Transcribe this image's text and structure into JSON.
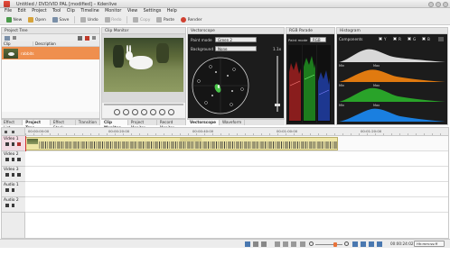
{
  "window": {
    "title": "Untitled / DVD/VID PAL [modified] – Kdenlive"
  },
  "menu": {
    "items": [
      "File",
      "Edit",
      "Project",
      "Tool",
      "Clip",
      "Timeline",
      "Monitor",
      "View",
      "Settings",
      "Help"
    ]
  },
  "toolbar": {
    "new_label": "New",
    "open_label": "Open",
    "save_label": "Save",
    "undo_label": "Undo",
    "redo_label": "Redo",
    "copy_label": "Copy",
    "paste_label": "Paste",
    "render_label": "Render"
  },
  "project_tree": {
    "title": "Project Tree",
    "col_clip": "Clip",
    "col_description": "Description",
    "clip_name": "rabbits"
  },
  "left_tabs": [
    "Effect List",
    "Project Tree",
    "Effect Stack",
    "Transition"
  ],
  "clip_monitor": {
    "title": "Clip Monitor",
    "tabs": [
      "Clip Monitor",
      "Project Monitor",
      "Record Monitor"
    ]
  },
  "vectorscope": {
    "title": "Vectorscope",
    "paint_mode_label": "Paint mode",
    "paint_mode_value": "Green 2",
    "background_label": "Background",
    "background_value": "None",
    "gain_value": "1.1x",
    "tabs": [
      "Vectorscope",
      "Waveform"
    ]
  },
  "rgb_parade": {
    "title": "RGB Parade",
    "paint_mode_label": "Paint mode",
    "paint_mode_value": "RGB"
  },
  "histogram": {
    "title": "Histogram",
    "components_label": "Components",
    "channel_labels": [
      "Y",
      "R",
      "G",
      "B"
    ],
    "min_label": "Min",
    "max_label": "Max"
  },
  "timeline": {
    "ruler_start": "00:00:00:00",
    "ruler_marks": [
      "00:00:20:00",
      "00:00:40:00",
      "00:01:00:00",
      "00:01:20:00"
    ],
    "tracks": [
      "Video 1",
      "Video 2",
      "Video 3",
      "Audio 1",
      "Audio 2"
    ]
  },
  "statusbar": {
    "timecode": "00:00:24:02",
    "mode": "Hh:mm:ss:ff"
  },
  "colors": {
    "accent": "#e8723a",
    "selection_orange": "#f0a36e",
    "clip_yellow": "#eee6a6",
    "video_track_pink": "#f3dbe3",
    "histogram_y": "#d8d8d8",
    "histogram_r": "#e07a10",
    "histogram_g": "#29a329",
    "histogram_b": "#1a7fe0"
  }
}
